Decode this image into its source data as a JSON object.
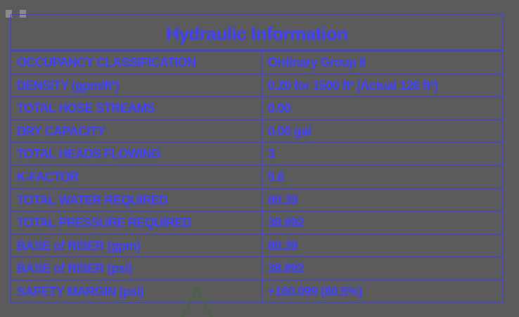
{
  "title": "Hydraulic Information",
  "rows": [
    {
      "label": "OCCUPANCY CLASSIFICATION",
      "value": "Ordinary Group II"
    },
    {
      "label": "DENSITY (gpm/ft²)",
      "value": "0.20 for 1500 ft² (Actual 126 ft²)"
    },
    {
      "label": "TOTAL HOSE STREAMS",
      "value": "0.00"
    },
    {
      "label": "DRY CAPACITY",
      "value": "0.00 gal"
    },
    {
      "label": "TOTAL HEADS FLOWING",
      "value": "3"
    },
    {
      "label": "K-FACTOR",
      "value": "5.6"
    },
    {
      "label": "TOTAL WATER REQUIRED",
      "value": "80.39"
    },
    {
      "label": "TOTAL PRESSURE REQUIRED",
      "value": "38.892"
    },
    {
      "label": "BASE of RISER (gpm)",
      "value": "80.39"
    },
    {
      "label": "BASE of RISER (psi)",
      "value": "38.892"
    },
    {
      "label": "SAFETY MARGIN (psi)",
      "value": "+160.099 (80.5%)"
    }
  ]
}
